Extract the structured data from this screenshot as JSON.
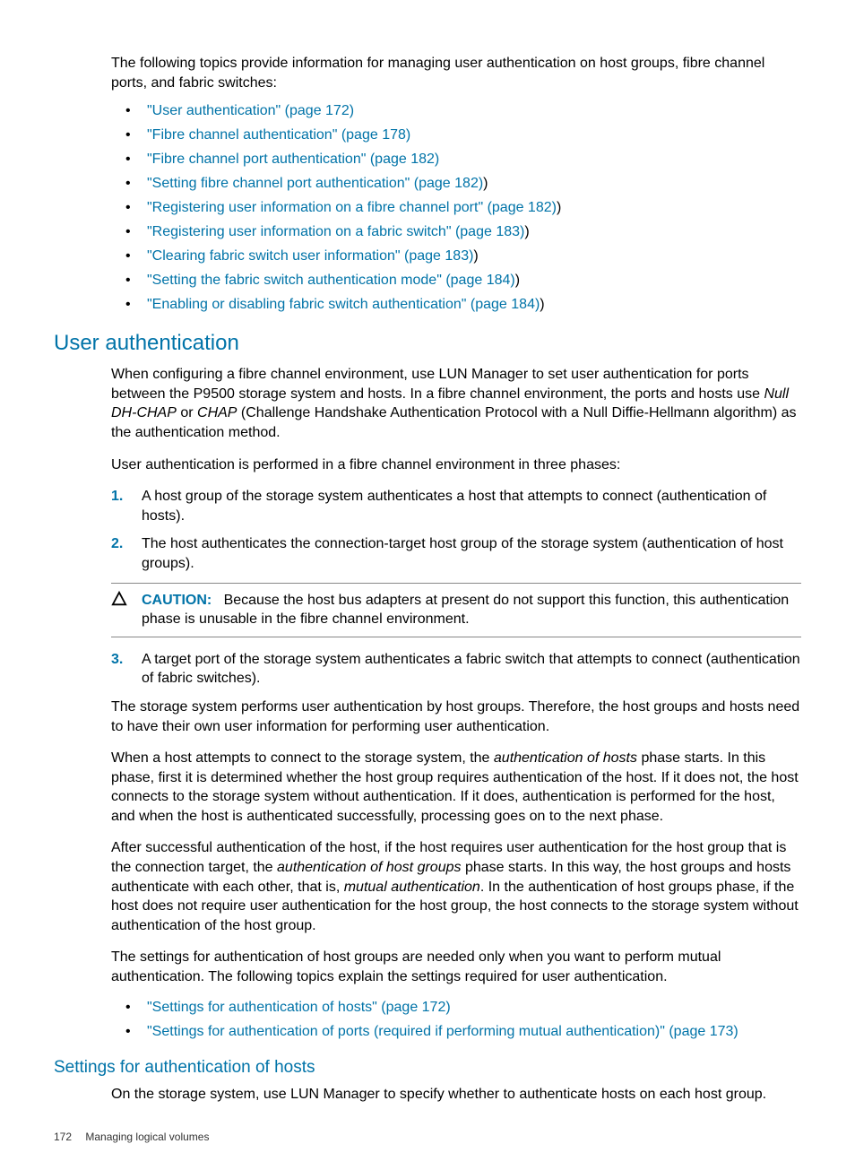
{
  "intro": "The following topics provide information for managing user authentication on host groups, fibre channel ports, and fabric switches:",
  "toplinks": [
    {
      "text": "\"User authentication\" (page 172)",
      "trail": ""
    },
    {
      "text": "\"Fibre channel authentication\" (page 178)",
      "trail": ""
    },
    {
      "text": "\"Fibre channel port authentication\" (page 182)",
      "trail": ""
    },
    {
      "text": "\"Setting fibre channel port authentication\" (page 182)",
      "trail": ")"
    },
    {
      "text": "\"Registering user information on a fibre channel port\" (page 182)",
      "trail": ")"
    },
    {
      "text": "\"Registering user information on a fabric switch\" (page 183)",
      "trail": ")"
    },
    {
      "text": "\"Clearing fabric switch user information\" (page 183)",
      "trail": ")"
    },
    {
      "text": "\"Setting the fabric switch authentication mode\" (page 184)",
      "trail": ")"
    },
    {
      "text": "\"Enabling or disabling fabric switch authentication\" (page 184)",
      "trail": ")"
    }
  ],
  "section1": {
    "heading": "User authentication",
    "p1a": "When configuring a fibre channel environment, use LUN Manager to set user authentication for ports between the P9500 storage system and hosts. In a fibre channel environment, the ports and hosts use ",
    "p1_em1": "Null DH-CHAP",
    "p1_mid": " or ",
    "p1_em2": "CHAP",
    "p1b": " (Challenge Handshake Authentication Protocol with a Null Diffie-Hellmann algorithm) as the authentication method.",
    "p2": "User authentication is performed in a fibre channel environment in three phases:",
    "steps": [
      "A host group of the storage system authenticates a host that attempts to connect (authentication of hosts).",
      "The host authenticates the connection-target host group of the storage system (authentication of host groups)."
    ],
    "caution_label": "CAUTION:",
    "caution_text": "Because the host bus adapters at present do not support this function, this authentication phase is unusable in the fibre channel environment.",
    "step3_num": "3.",
    "step3": "A target port of the storage system authenticates a fabric switch that attempts to connect (authentication of fabric switches).",
    "p3": "The storage system performs user authentication by host groups. Therefore, the host groups and hosts need to have their own user information for performing user authentication.",
    "p4a": "When a host attempts to connect to the storage system, the ",
    "p4_em1": "authentication of hosts",
    "p4b": " phase starts. In this phase, first it is determined whether the host group requires authentication of the host. If it does not, the host connects to the storage system without authentication. If it does, authentication is performed for the host, and when the host is authenticated successfully, processing goes on to the next phase.",
    "p5a": "After successful authentication of the host, if the host requires user authentication for the host group that is the connection target, the ",
    "p5_em1": "authentication of host groups",
    "p5b": " phase starts. In this way, the host groups and hosts authenticate with each other, that is, ",
    "p5_em2": "mutual authentication",
    "p5c": ". In the authentication of host groups phase, if the host does not require user authentication for the host group, the host connects to the storage system without authentication of the host group.",
    "p6": "The settings for authentication of host groups are needed only when you want to perform mutual authentication. The following topics explain the settings required for user authentication.",
    "links2": [
      {
        "text": "\"Settings for authentication of hosts\" (page 172)",
        "trail": ""
      },
      {
        "text": "\"Settings for authentication of ports (required if performing mutual authentication)\" (page 173)",
        "trail": ""
      }
    ]
  },
  "section2": {
    "heading": "Settings for authentication of hosts",
    "p1": "On the storage system, use LUN Manager to specify whether to authenticate hosts on each host group."
  },
  "footer": {
    "page": "172",
    "title": "Managing logical volumes"
  },
  "nums": {
    "n1": "1.",
    "n2": "2."
  }
}
